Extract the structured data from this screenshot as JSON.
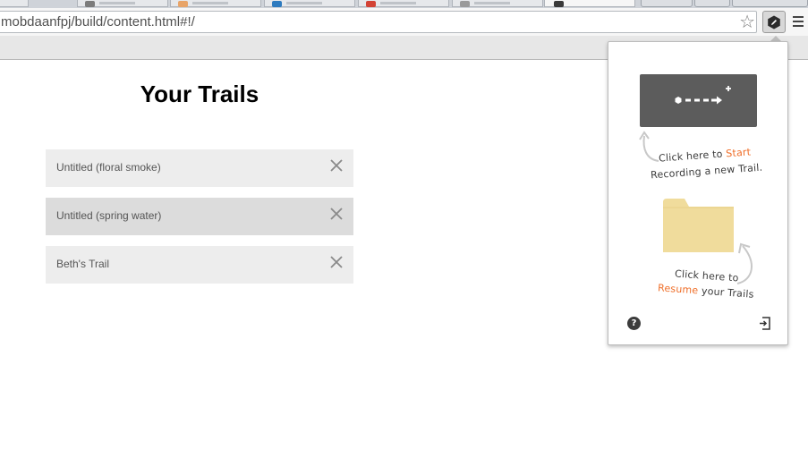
{
  "browser": {
    "url": "mobdaanfpj/build/content.html#!/",
    "tab_colors": [
      "#8a8a8a",
      "#7c7c7c",
      "#e8a468",
      "#2e7bbf",
      "#d34335",
      "#9a9a9a"
    ],
    "bookmark_icon": "star-icon",
    "extension_icon": "trails-pencil-icon",
    "menu_icon": "hamburger-menu-icon"
  },
  "page": {
    "title": "Your Trails",
    "trails": [
      {
        "name": "Untitled (floral smoke)",
        "close_icon": "close-icon"
      },
      {
        "name": "Untitled (spring water)",
        "close_icon": "close-icon"
      },
      {
        "name": "Beth's Trail",
        "close_icon": "close-icon"
      }
    ]
  },
  "popup": {
    "start_hint_prefix": "Click here to ",
    "start_hint_accent": "Start",
    "start_hint_line2": "Recording a new Trail.",
    "resume_hint_line1": "Click here to",
    "resume_hint_accent": "Resume",
    "resume_hint_suffix": " your Trails",
    "help_label": "?",
    "colors": {
      "accent": "#ef6d27",
      "start_button": "#5c5c5c",
      "folder": "#f0dc9c"
    }
  }
}
